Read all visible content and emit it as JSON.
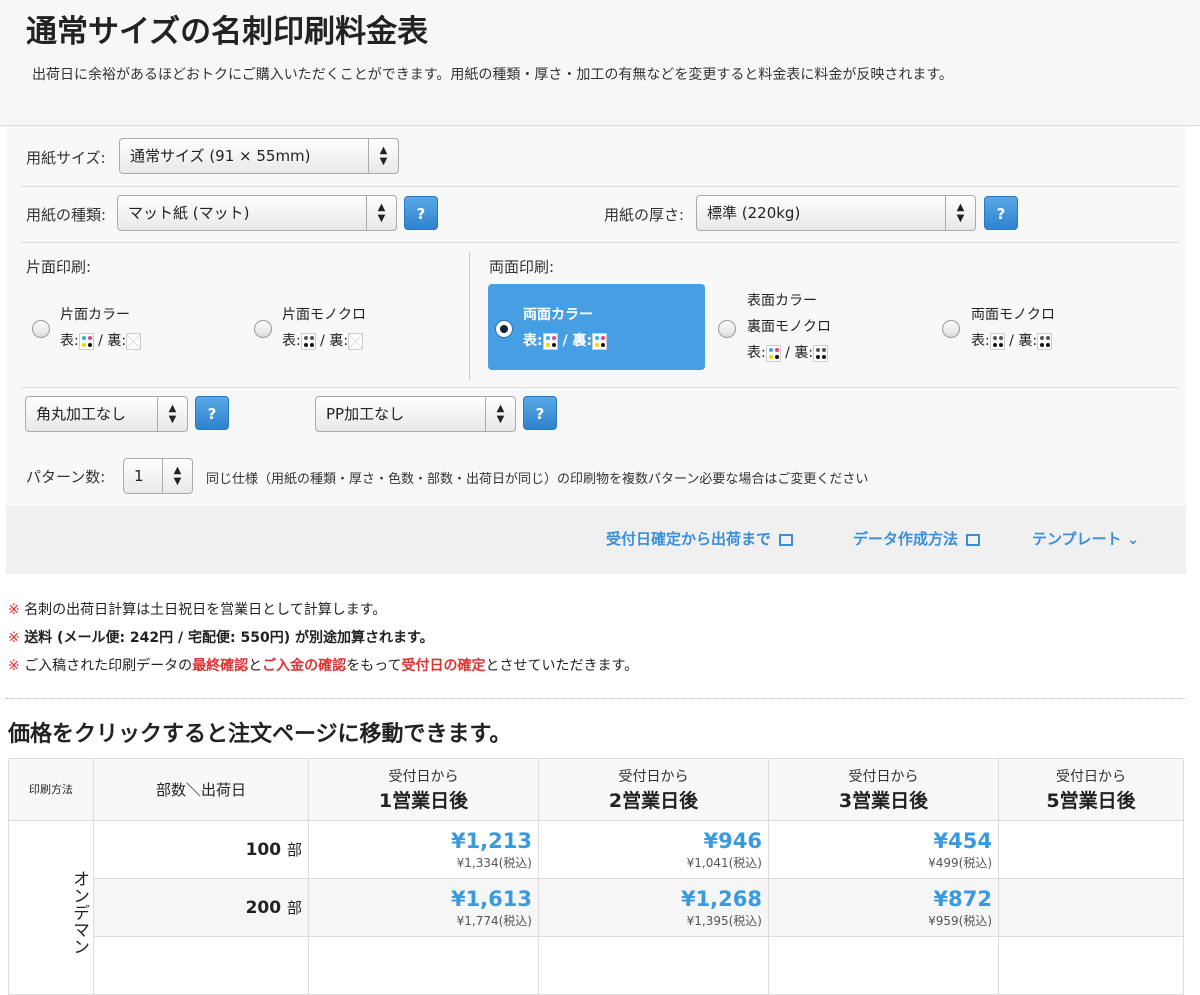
{
  "header": {
    "title": "通常サイズの名刺印刷料金表",
    "description": "出荷日に余裕があるほどおトクにご購入いただくことができます。用紙の種類・厚さ・加工の有無などを変更すると料金表に料金が反映されます。"
  },
  "form": {
    "size_label": "用紙サイズ:",
    "size_value": "通常サイズ (91 × 55mm)",
    "type_label": "用紙の種類:",
    "type_value": "マット紙 (マット)",
    "thickness_label": "用紙の厚さ:",
    "thickness_value": "標準 (220kg)",
    "help": "?",
    "single_label": "片面印刷:",
    "double_label": "両面印刷:",
    "front": "表:",
    "back": "裏:",
    "slash": "/",
    "options": [
      {
        "name": "片面カラー",
        "selected": false
      },
      {
        "name": "片面モノクロ",
        "selected": false
      },
      {
        "name": "両面カラー",
        "selected": true
      },
      {
        "name": "表面カラー",
        "name2": "裏面モノクロ",
        "selected": false
      },
      {
        "name": "両面モノクロ",
        "selected": false
      }
    ],
    "corner_value": "角丸加工なし",
    "pp_value": "PP加工なし",
    "pattern_label": "パターン数:",
    "pattern_value": "1",
    "pattern_note": "同じ仕様（用紙の種類・厚さ・色数・部数・出荷日が同じ）の印刷物を複数パターン必要な場合はご変更ください"
  },
  "links": {
    "schedule": "受付日確定から出荷まで",
    "data": "データ作成方法",
    "template": "テンプレート"
  },
  "notes": {
    "mark": "※",
    "n1": "名刺の出荷日計算は土日祝日を営業日として計算します。",
    "n2": "送料 (メール便: 242円 / 宅配便: 550円) が別途加算されます。",
    "n3a": "ご入稿された印刷データの",
    "n3b": "最終確認",
    "n3c": "と",
    "n3d": "ご入金の確認",
    "n3e": "をもって",
    "n3f": "受付日の確定",
    "n3g": "とさせていただきます。"
  },
  "table": {
    "heading": "価格をクリックすると注文ページに移動できます。",
    "method_header": "印刷方法",
    "qty_header": "部数＼出荷日",
    "columns": [
      {
        "sub": "受付日から",
        "main": "1営業日後"
      },
      {
        "sub": "受付日から",
        "main": "2営業日後"
      },
      {
        "sub": "受付日から",
        "main": "3営業日後"
      },
      {
        "sub": "受付日から",
        "main": "5営業日後"
      }
    ],
    "method": "オンデマン",
    "unit": "部",
    "rows": [
      {
        "qty": "100",
        "prices": [
          {
            "p": "¥1,213",
            "t": "¥1,334(税込)"
          },
          {
            "p": "¥946",
            "t": "¥1,041(税込)"
          },
          {
            "p": "¥454",
            "t": "¥499(税込)"
          },
          {
            "p": "",
            "t": ""
          }
        ]
      },
      {
        "qty": "200",
        "prices": [
          {
            "p": "¥1,613",
            "t": "¥1,774(税込)"
          },
          {
            "p": "¥1,268",
            "t": "¥1,395(税込)"
          },
          {
            "p": "¥872",
            "t": "¥959(税込)"
          },
          {
            "p": "",
            "t": ""
          }
        ]
      }
    ]
  }
}
